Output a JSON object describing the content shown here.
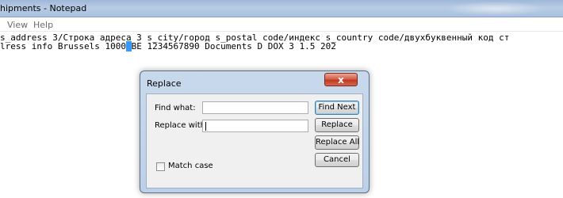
{
  "window": {
    "title": "hipments - Notepad"
  },
  "menu": {
    "items": [
      "View",
      "Help"
    ]
  },
  "document": {
    "header_line": "   s_address 3/Строка адреса 3    s_city/город    s_postal code/индекс    s_country code/двухбуквенный код ст",
    "data_line_before_selection": "lress info  Brussels         1000",
    "selected_text": "      ",
    "data_line_after_selection": "BE        1234567890         Documents          D       DOX     3       1.5      202"
  },
  "dialog": {
    "title": "Replace",
    "close_label": "x",
    "find_what_label": "Find what:",
    "find_what_value": "",
    "replace_with_label": "Replace with:",
    "replace_with_value": "",
    "buttons": {
      "find_next": "Find Next",
      "replace": "Replace",
      "replace_all": "Replace All",
      "cancel": "Cancel"
    },
    "match_case_label": "Match case",
    "match_case_checked": false
  },
  "colors": {
    "selection": "#3399ff",
    "close_button": "#c13a22",
    "titlebar": "#a9c0de"
  }
}
